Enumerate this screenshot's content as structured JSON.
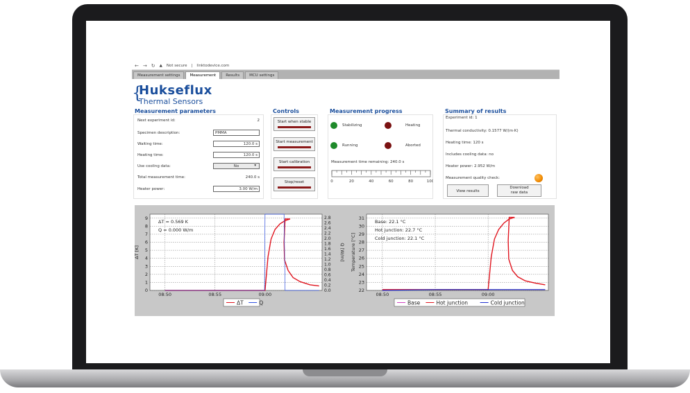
{
  "browser": {
    "security": "Not secure",
    "url": "linktodevice.com",
    "tabs": [
      "Measurement settings",
      "Measurement",
      "Results",
      "MCU settings"
    ],
    "active_tab": "Measurement"
  },
  "logo": {
    "name": "Hukseflux",
    "sub": "Thermal Sensors"
  },
  "parameters": {
    "title": "Measurement parameters",
    "next_id_label": "Next experiment id:",
    "next_id_value": "2",
    "specimen_label": "Specimen description:",
    "specimen_value": "PMMA",
    "waiting_label": "Waiting time:",
    "waiting_value": "120.0 s",
    "heating_label": "Heating time:",
    "heating_value": "120.0 s",
    "cooling_label": "Use cooling data:",
    "cooling_value": "No",
    "total_label": "Total measurement time:",
    "total_value": "240.0 s",
    "power_label": "Heater power:",
    "power_value": "3.00 W/m"
  },
  "controls": {
    "title": "Controls",
    "start_stable": "Start when stable",
    "start_measurement": "Start measurement",
    "start_calibration": "Start calibration",
    "stop_reset": "Stop/reset"
  },
  "progress": {
    "title": "Measurement progress",
    "stabilizing": "Stabilizing",
    "heating": "Heating",
    "running": "Running",
    "aborted": "Aborted",
    "remaining": "Measurement time remaining: 240.0 s",
    "scale_labels": [
      "0",
      "20",
      "40",
      "60",
      "80",
      "100"
    ],
    "progress_percent": 0
  },
  "summary": {
    "title": "Summary of results",
    "experiment_id": "Experiment id: 1",
    "conductivity": "Thermal conductivity: 0.1577 W/(m·K)",
    "heating_time": "Heating time: 120 s",
    "cooling": "Includes cooling data: no",
    "heater_power": "Heater power: 2.952 W/m",
    "quality_label": "Measurement quality check:",
    "view_results": "View results",
    "download_line1": "Download",
    "download_line2": "raw data"
  },
  "colors": {
    "brand": "#1a4e9c",
    "led_green": "#1e8a2a",
    "led_red": "#7a1212",
    "led_orange": "#f08a00",
    "dt_line": "#e0141e",
    "q_line": "#3050e0",
    "base_line": "#d040c0",
    "cold_line": "#2030d0"
  },
  "chart_data": [
    {
      "type": "line",
      "annotations": [
        "ΔT = 0.569 K",
        "Q = 0.000 W/m"
      ],
      "ylabel": "ΔT [K]",
      "y2label": "Q [W/m]",
      "x_ticks": [
        "08:50",
        "08:55",
        "09:00"
      ],
      "y_ticks": [
        "0",
        "1",
        "2",
        "3",
        "4",
        "5",
        "6",
        "7",
        "8",
        "9"
      ],
      "y2_ticks": [
        "0.0",
        "0.2",
        "0.4",
        "0.6",
        "0.8",
        "1.0",
        "1.2",
        "1.4",
        "1.6",
        "1.8",
        "2.0",
        "2.2",
        "2.4",
        "2.6",
        "2.8"
      ],
      "ylim": [
        0,
        9.5
      ],
      "y2lim": [
        0,
        2.93
      ],
      "legend": [
        "ΔT",
        "Q"
      ],
      "series": [
        {
          "name": "ΔT",
          "x_min": [
            -10,
            -5,
            -0.2,
            0,
            0.3,
            0.6,
            1,
            1.5,
            2,
            2.5,
            2,
            1.9,
            1.95,
            2.3,
            2.8,
            3.5,
            4.5,
            5.4
          ],
          "values": [
            0,
            0,
            0,
            0,
            4.2,
            6.4,
            7.6,
            8.3,
            8.7,
            8.9,
            8.9,
            6.0,
            3.8,
            2.5,
            1.6,
            1.1,
            0.7,
            0.55
          ]
        },
        {
          "name": "Q",
          "x_min": [
            -10,
            -1,
            -0.05,
            0,
            1.9,
            2.0,
            5.4
          ],
          "values": [
            0,
            0,
            0,
            2.93,
            2.93,
            0,
            0
          ]
        }
      ]
    },
    {
      "type": "line",
      "annotations": [
        "Base: 22.1 °C",
        "Hot junction: 22.7 °C",
        "Cold junction: 22.1 °C"
      ],
      "ylabel": "Temperature [°C]",
      "x_ticks": [
        "08:50",
        "08:55",
        "09:00"
      ],
      "y_ticks": [
        "22",
        "23",
        "24",
        "25",
        "26",
        "27",
        "28",
        "29",
        "30",
        "31"
      ],
      "ylim": [
        22,
        31.5
      ],
      "legend": [
        "Base",
        "Hot junction",
        "Cold junction"
      ],
      "series": [
        {
          "name": "Base",
          "x_min": [
            -10,
            5.4
          ],
          "values": [
            22.1,
            22.1
          ]
        },
        {
          "name": "Hot junction",
          "x_min": [
            -10,
            -5,
            -0.2,
            0,
            0.3,
            0.6,
            1,
            1.5,
            2,
            2.5,
            2,
            1.9,
            1.95,
            2.3,
            2.8,
            3.5,
            4.5,
            5.4
          ],
          "values": [
            22.1,
            22.1,
            22.1,
            22.1,
            26.2,
            28.4,
            29.6,
            30.4,
            30.9,
            31.1,
            31.1,
            28.2,
            25.9,
            24.5,
            23.7,
            23.2,
            22.9,
            22.7
          ]
        },
        {
          "name": "Cold junction",
          "x_min": [
            -10,
            -5,
            5.4
          ],
          "values": [
            22.0,
            22.1,
            22.1
          ]
        }
      ]
    }
  ]
}
